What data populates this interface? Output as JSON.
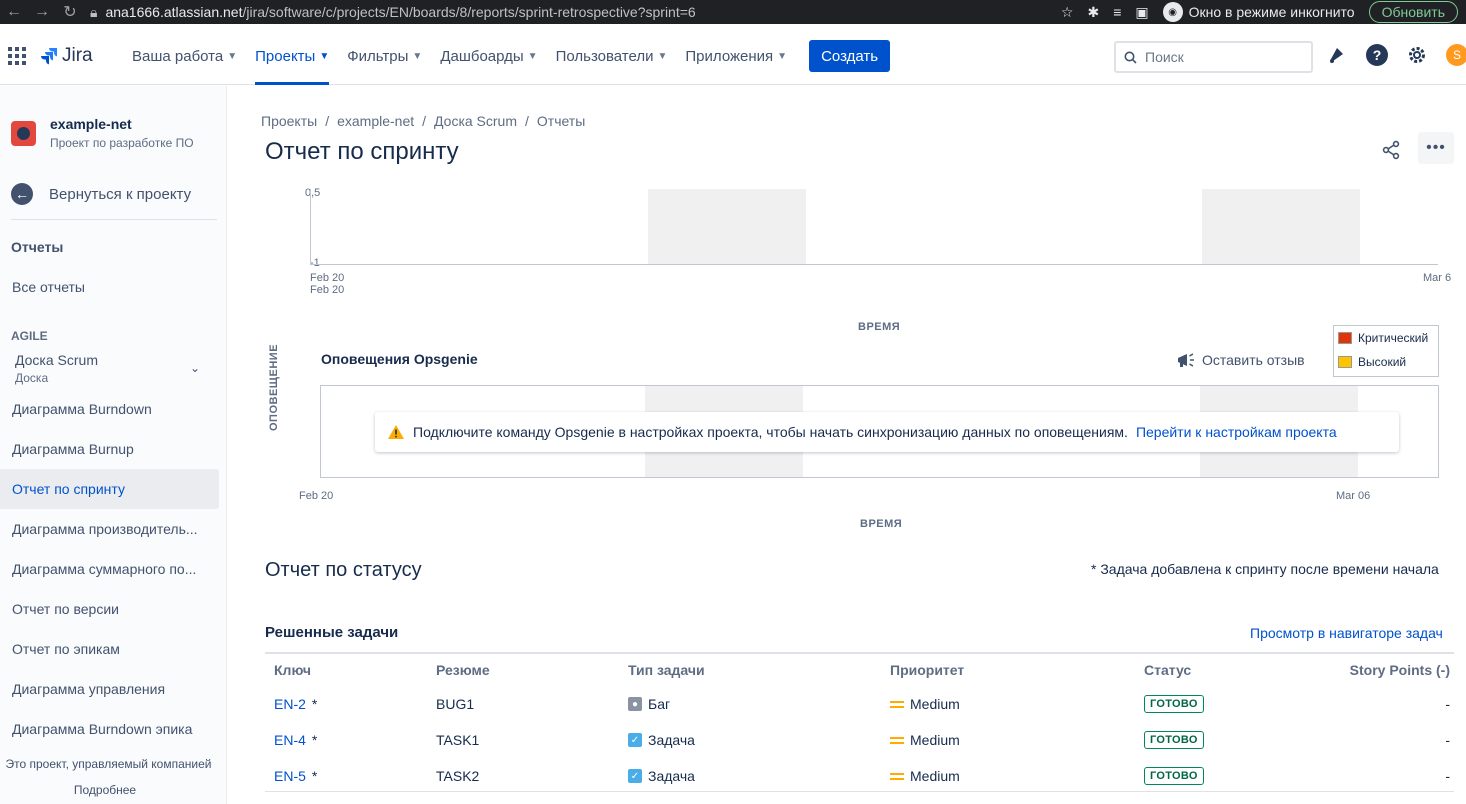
{
  "browser": {
    "url_host": "ana1666.atlassian.net",
    "url_path": "/jira/software/c/projects/EN/boards/8/reports/sprint-retrospective?sprint=6",
    "incognito_label": "Окно в режиме инкогнито",
    "update_label": "Обновить"
  },
  "nav": {
    "logo": "Jira",
    "items": [
      {
        "label": "Ваша работа"
      },
      {
        "label": "Проекты"
      },
      {
        "label": "Фильтры"
      },
      {
        "label": "Дашбоарды"
      },
      {
        "label": "Пользователи"
      },
      {
        "label": "Приложения"
      }
    ],
    "create_label": "Создать",
    "search_placeholder": "Поиск",
    "avatar_initial": "S"
  },
  "sidebar": {
    "project_name": "example-net",
    "project_type": "Проект по разработке ПО",
    "back_label": "Вернуться к проекту",
    "reports_heading": "Отчеты",
    "all_reports": "Все отчеты",
    "agile_section": "AGILE",
    "board_title": "Доска Scrum",
    "board_sub": "Доска",
    "items": [
      {
        "label": "Диаграмма Burndown"
      },
      {
        "label": "Диаграмма Burnup"
      },
      {
        "label": "Отчет по спринту"
      },
      {
        "label": "Диаграмма производитель..."
      },
      {
        "label": "Диаграмма суммарного по..."
      },
      {
        "label": "Отчет по версии"
      },
      {
        "label": "Отчет по эпикам"
      },
      {
        "label": "Диаграмма управления"
      },
      {
        "label": "Диаграмма Burndown эпика"
      }
    ],
    "footer": "Это проект, управляемый компанией",
    "more": "Подробнее"
  },
  "main": {
    "breadcrumb": [
      "Проекты",
      "example-net",
      "Доска Scrum",
      "Отчеты"
    ],
    "title": "Отчет по спринту",
    "chart1": {
      "y_ticks": [
        "0,5",
        "-1"
      ],
      "x_start_1": "Feb 20",
      "x_start_2": "Feb 20",
      "x_end": "Mar 6",
      "x_title": "ВРЕМЯ"
    },
    "legend": [
      {
        "label": "Критический",
        "color": "#DE350B"
      },
      {
        "label": "Высокий",
        "color": "#FFC400"
      }
    ],
    "opsgenie": {
      "title": "Оповещения Opsgenie",
      "feedback": "Оставить отзыв",
      "y_title": "ОПОВЕЩЕНИЕ",
      "warning": "Подключите команду Opsgenie в настройках проекта, чтобы начать синхронизацию данных по оповещениям.",
      "warning_link": "Перейти к настройкам проекта",
      "x_start": "Feb 20",
      "x_end": "Mar 06",
      "x_title": "ВРЕМЯ"
    },
    "status_title": "Отчет по статусу",
    "status_note": "* Задача добавлена к спринту после времени начала",
    "resolved_title": "Решенные задачи",
    "navigator_link": "Просмотр в навигаторе задач",
    "columns": {
      "key": "Ключ",
      "summary": "Резюме",
      "type": "Тип задачи",
      "priority": "Приоритет",
      "status": "Статус",
      "sp": "Story Points (-)"
    },
    "rows": [
      {
        "key": "EN-2",
        "mark": "*",
        "summary": "BUG1",
        "type": "Баг",
        "priority": "Medium",
        "status": "ГОТОВО",
        "sp": "-"
      },
      {
        "key": "EN-4",
        "mark": "*",
        "summary": "TASK1",
        "type": "Задача",
        "priority": "Medium",
        "status": "ГОТОВО",
        "sp": "-"
      },
      {
        "key": "EN-5",
        "mark": "*",
        "summary": "TASK2",
        "type": "Задача",
        "priority": "Medium",
        "status": "ГОТОВО",
        "sp": "-"
      }
    ]
  }
}
